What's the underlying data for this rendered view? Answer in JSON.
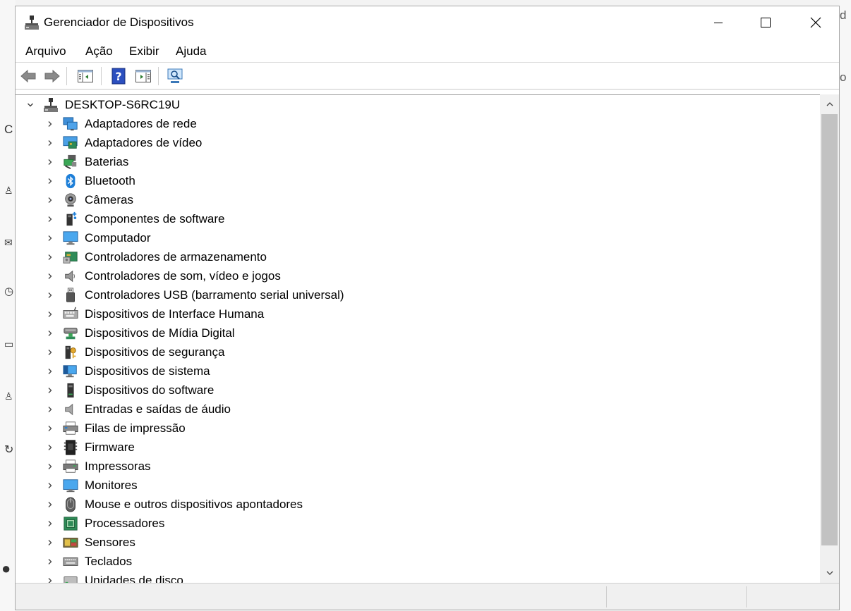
{
  "window": {
    "title": "Gerenciador de Dispositivos",
    "controls": [
      "minimize",
      "maximize",
      "close"
    ]
  },
  "menu": [
    "Arquivo",
    "Ação",
    "Exibir",
    "Ajuda"
  ],
  "toolbar": [
    {
      "name": "back-icon"
    },
    {
      "name": "forward-icon"
    },
    {
      "name": "show-hide-console-tree-icon"
    },
    {
      "name": "help-icon"
    },
    {
      "name": "action-pane-icon"
    },
    {
      "name": "scan-hardware-icon"
    }
  ],
  "tree": {
    "root": "DESKTOP-S6RC19U",
    "categories": [
      {
        "label": "Adaptadores de rede",
        "icon": "network-adapter-icon"
      },
      {
        "label": "Adaptadores de vídeo",
        "icon": "display-adapter-icon"
      },
      {
        "label": "Baterias",
        "icon": "battery-icon"
      },
      {
        "label": "Bluetooth",
        "icon": "bluetooth-icon"
      },
      {
        "label": "Câmeras",
        "icon": "camera-icon"
      },
      {
        "label": "Componentes de software",
        "icon": "software-component-icon"
      },
      {
        "label": "Computador",
        "icon": "computer-icon"
      },
      {
        "label": "Controladores de armazenamento",
        "icon": "storage-controller-icon"
      },
      {
        "label": "Controladores de som, vídeo e jogos",
        "icon": "speaker-icon"
      },
      {
        "label": "Controladores USB (barramento serial universal)",
        "icon": "usb-icon"
      },
      {
        "label": "Dispositivos de Interface Humana",
        "icon": "hid-icon"
      },
      {
        "label": "Dispositivos de Mídia Digital",
        "icon": "digital-media-icon"
      },
      {
        "label": "Dispositivos de segurança",
        "icon": "security-device-icon"
      },
      {
        "label": "Dispositivos de sistema",
        "icon": "system-device-icon"
      },
      {
        "label": "Dispositivos do software",
        "icon": "software-device-icon"
      },
      {
        "label": "Entradas e saídas de áudio",
        "icon": "audio-io-icon"
      },
      {
        "label": "Filas de impressão",
        "icon": "print-queue-icon"
      },
      {
        "label": "Firmware",
        "icon": "firmware-icon"
      },
      {
        "label": "Impressoras",
        "icon": "printer-icon"
      },
      {
        "label": "Monitores",
        "icon": "monitor-icon"
      },
      {
        "label": "Mouse e outros dispositivos apontadores",
        "icon": "mouse-icon"
      },
      {
        "label": "Processadores",
        "icon": "processor-icon"
      },
      {
        "label": "Sensores",
        "icon": "sensor-icon"
      },
      {
        "label": "Teclados",
        "icon": "keyboard-icon"
      },
      {
        "label": "Unidades de disco",
        "icon": "disk-drive-icon"
      }
    ]
  },
  "colors": {
    "accent_blue": "#1e7fd8",
    "window_border": "#a9a9a9",
    "scrollbar_thumb": "#c2c2c2"
  }
}
